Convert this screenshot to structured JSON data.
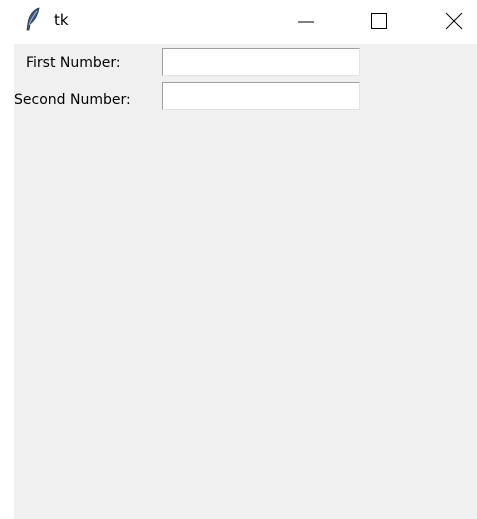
{
  "window": {
    "title": "tk",
    "controls": {
      "minimize_icon": "minimize-icon",
      "maximize_icon": "maximize-icon",
      "close_icon": "close-icon"
    }
  },
  "form": {
    "first": {
      "label": "First Number:",
      "value": "",
      "placeholder": ""
    },
    "second": {
      "label": "Second Number:",
      "value": "",
      "placeholder": ""
    }
  },
  "colors": {
    "client_background": "#f0f0f0",
    "titlebar_background": "#ffffff",
    "entry_background": "#ffffff"
  }
}
